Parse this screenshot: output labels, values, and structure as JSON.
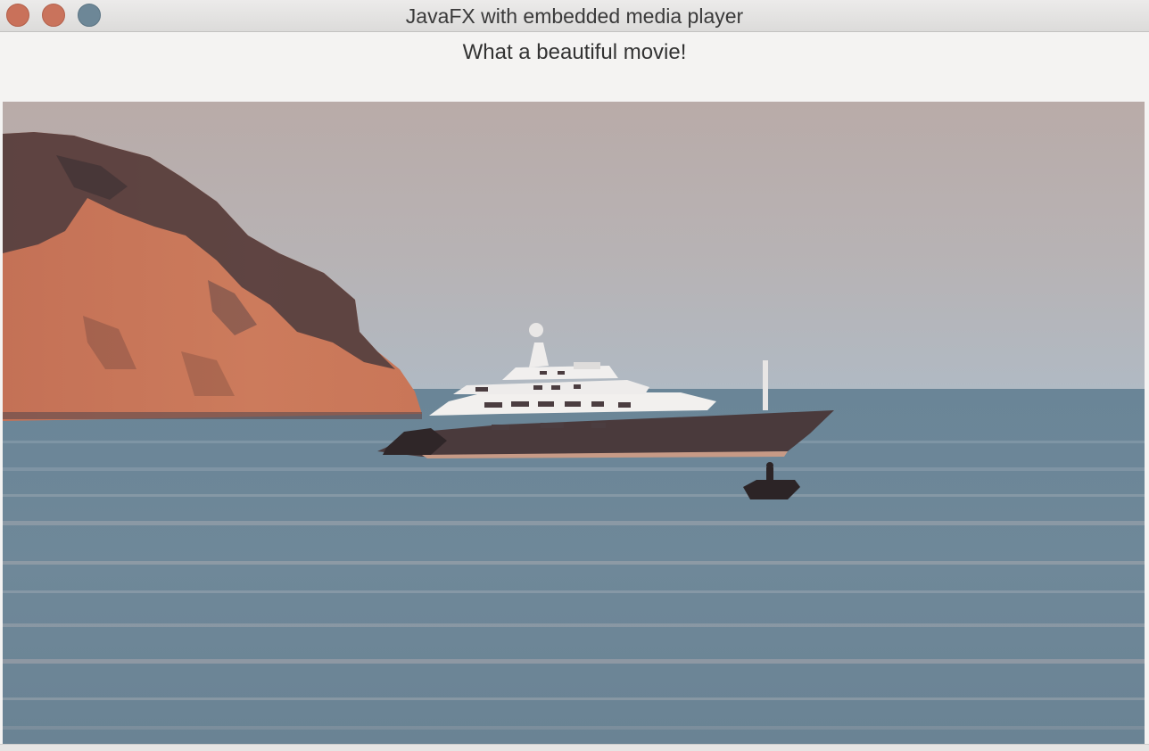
{
  "window": {
    "title": "JavaFX with embedded media player",
    "buttons": [
      "close",
      "minimize",
      "zoom"
    ]
  },
  "content": {
    "caption": "What a beautiful movie!"
  },
  "media": {
    "description_icon": "video-frame",
    "colors": {
      "sky_top": "#b7aaa7",
      "sky_bottom": "#b3b9c2",
      "sea": "#6b8596",
      "cliff": "#c9785a",
      "yacht_hull": "#4a3a3c",
      "yacht_superstructure": "#f2f0ee"
    }
  }
}
